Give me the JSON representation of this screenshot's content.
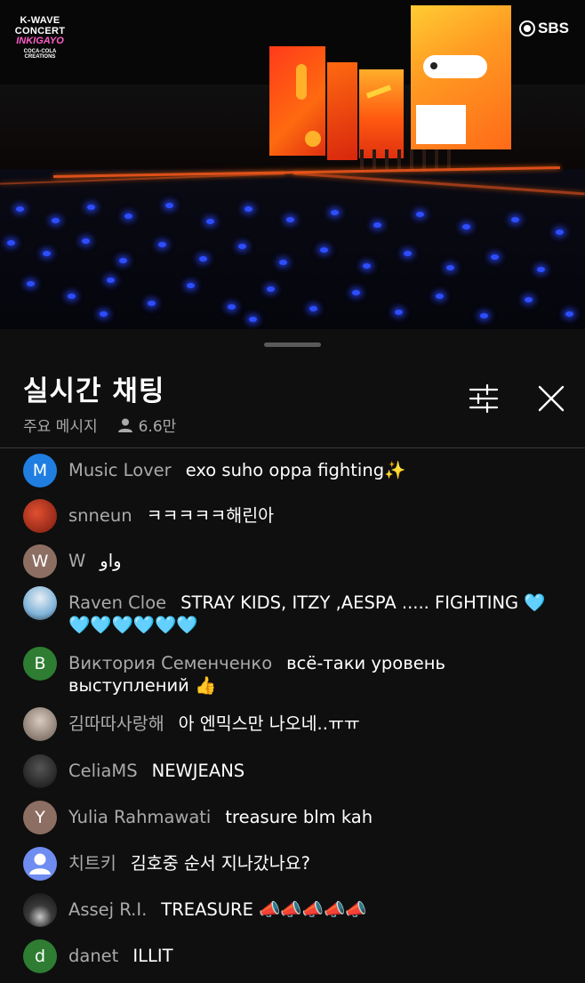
{
  "video": {
    "logo_left": [
      "K-WAVE",
      "CONCERT",
      "INKIGAYO",
      "COCA-COLA CREATIONS"
    ],
    "logo_right": "SBS"
  },
  "chat_header": {
    "title": "실시간 채팅",
    "mode": "주요 메시지",
    "viewers": "6.6만",
    "icons": [
      "tune-icon",
      "close-icon",
      "person-icon"
    ]
  },
  "messages": [
    {
      "avatar_letter": "M",
      "avatar_color": "#1f7ee0",
      "author": "Music Lover",
      "text": "exo suho oppa fighting✨"
    },
    {
      "avatar_letter": "",
      "avatar_color": "#b03020",
      "author": "snneun",
      "text": "ㅋㅋㅋㅋㅋ해린아"
    },
    {
      "avatar_letter": "W",
      "avatar_color": "#8d6e63",
      "author": "W",
      "text": "واو"
    },
    {
      "avatar_letter": "",
      "avatar_color": "#7fb3d8",
      "author": "Raven Cloe",
      "text": "STRAY KIDS, ITZY ,AESPA ..... FIGHTING 🩵🩵🩵🩵🩵🩵🩵"
    },
    {
      "avatar_letter": "B",
      "avatar_color": "#2e7d32",
      "author": "Виктория Семенченко",
      "text": "всё-таки уровень выступлений 👍"
    },
    {
      "avatar_letter": "",
      "avatar_color": "#9a8a80",
      "author": "김따따사랑해",
      "text": "아 엔믹스만 나오네..ㅠㅠ"
    },
    {
      "avatar_letter": "",
      "avatar_color": "#2a2a2a",
      "author": "CeliaMS",
      "text": "NEWJEANS"
    },
    {
      "avatar_letter": "Y",
      "avatar_color": "#8d6e63",
      "author": "Yulia Rahmawati",
      "text": "treasure blm kah"
    },
    {
      "avatar_letter": "",
      "avatar_color": "#6f8df0",
      "author": "치트키",
      "text": "김호중 순서 지나갔나요?"
    },
    {
      "avatar_letter": "",
      "avatar_color": "#3a3a3a",
      "author": "Assej R.I.",
      "text": "TREASURE 📣📣📣📣📣"
    },
    {
      "avatar_letter": "d",
      "avatar_color": "#2e7d32",
      "author": "danet",
      "text": "ILLIT"
    }
  ]
}
